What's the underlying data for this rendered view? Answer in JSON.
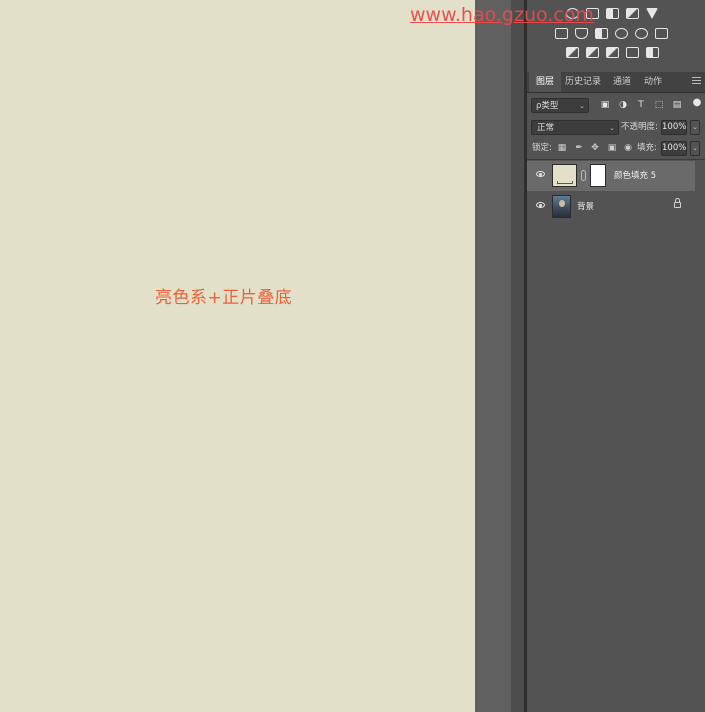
{
  "canvas": {
    "annotation": "亮色系+正片叠底",
    "fill_color": "#e2e0c9"
  },
  "watermark": "www.hao.gzuo.com",
  "adjustments": {
    "row1_icons": [
      "brightness-icon",
      "levels-icon",
      "curves-icon",
      "exposure-icon",
      "vibrance-triangle-icon"
    ],
    "row2_icons": [
      "hsl-icon",
      "color-balance-icon",
      "black-white-icon",
      "photo-filter-icon",
      "channel-mixer-icon",
      "color-lookup-icon"
    ],
    "row3_icons": [
      "invert-icon",
      "posterize-icon",
      "threshold-icon",
      "selective-color-icon",
      "gradient-map-icon"
    ]
  },
  "panel": {
    "tabs": [
      "图层",
      "历史记录",
      "通道",
      "动作"
    ],
    "active_tab": "图层",
    "filter_kind": "ρ类型",
    "blend_mode": "正常",
    "opacity_label": "不透明度:",
    "opacity_value": "100%",
    "lock_label": "锁定:",
    "fill_label": "填充:",
    "fill_value": "100%"
  },
  "layers": [
    {
      "name": "颜色填充 5",
      "selected": true,
      "visible": true,
      "type": "color-fill"
    },
    {
      "name": "背景",
      "selected": false,
      "visible": true,
      "type": "photo",
      "locked": true
    }
  ],
  "colors": {
    "canvas": "#e2e0c9",
    "annotation": "#e8623a",
    "watermark": "#e84a4a",
    "panel": "#535353",
    "selected_layer": "#6a6a6a"
  }
}
